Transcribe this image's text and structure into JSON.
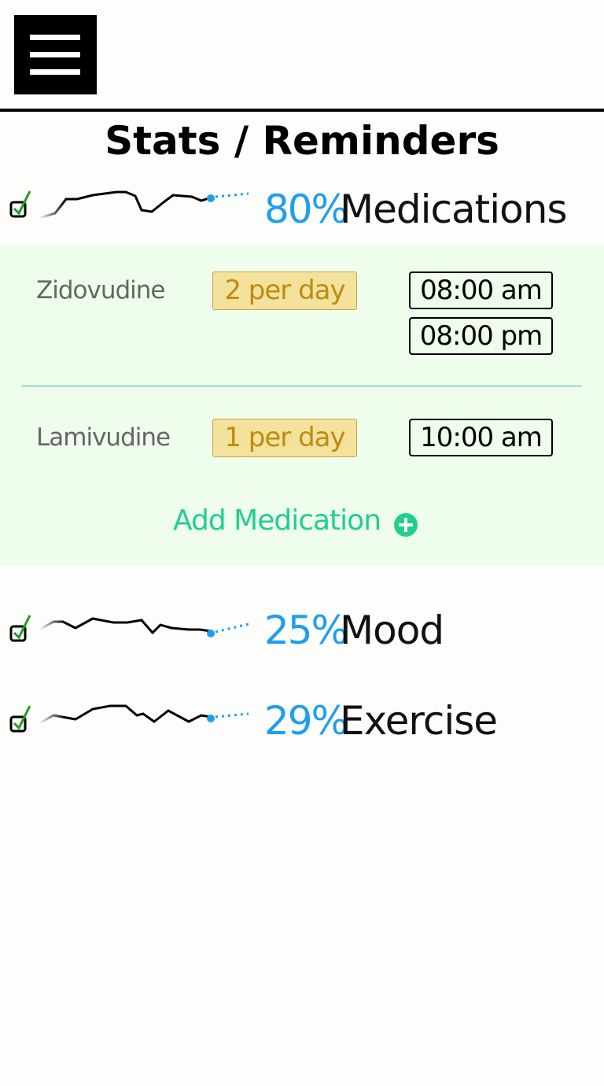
{
  "header": {
    "menu_icon": "hamburger-menu-icon"
  },
  "page": {
    "title": "Stats / Reminders"
  },
  "stats": [
    {
      "percent": "80%",
      "name": "Medications",
      "checked": true
    },
    {
      "percent": "25%",
      "name": "Mood",
      "checked": true
    },
    {
      "percent": "29%",
      "name": "Exercise",
      "checked": true
    }
  ],
  "medications": {
    "items": [
      {
        "name": "Zidovudine",
        "frequency": "2 per day",
        "times": [
          "08:00 am",
          "08:00 pm"
        ]
      },
      {
        "name": "Lamivudine",
        "frequency": "1 per day",
        "times": [
          "10:00 am"
        ]
      }
    ],
    "add_label": "Add Medication",
    "add_icon": "plus-circle-icon"
  },
  "colors": {
    "accent_blue": "#1e9fec",
    "panel_bg": "#effded",
    "add_green": "#20cf8f",
    "freq_bg": "#f2e29b",
    "freq_text": "#c08a12"
  }
}
